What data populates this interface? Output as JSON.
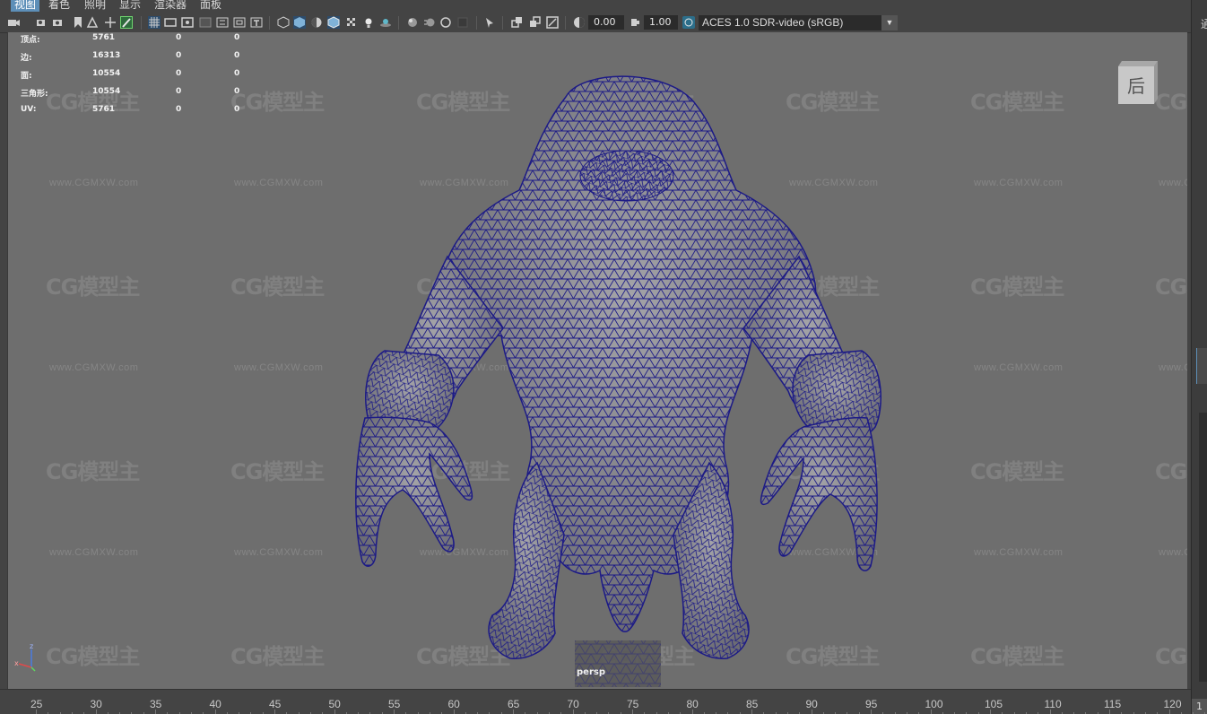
{
  "menu": {
    "items": [
      {
        "label": "视图",
        "active": true
      },
      {
        "label": "着色",
        "active": false
      },
      {
        "label": "照明",
        "active": false
      },
      {
        "label": "显示",
        "active": false
      },
      {
        "label": "渲染器",
        "active": false
      },
      {
        "label": "面板",
        "active": false
      }
    ]
  },
  "toolbar": {
    "exposure_value": "0.00",
    "gamma_value": "1.00",
    "color_space": "ACES 1.0 SDR-video (sRGB)",
    "icons": [
      "camera-select-icon",
      "camera-attributes-icon",
      "bookmark-icon",
      "image-plane-icon",
      "grease-pencil-icon",
      "grid-icon",
      "film-gate-icon",
      "resolution-gate-icon",
      "gate-mask-icon",
      "field-chart-icon",
      "safe-action-icon",
      "safe-title-icon",
      "wireframe-icon",
      "smooth-shade-icon",
      "default-material-icon",
      "wireframe-on-shaded-icon",
      "xray-icon",
      "textured-icon",
      "lights-icon",
      "shadows-icon",
      "ambient-occlusion-icon",
      "motion-blur-icon",
      "antialiasing-icon",
      "depth-of-field-icon",
      "isolate-select-icon",
      "xray-joints-icon",
      "xray-active-icon",
      "backface-icon",
      "exposure-icon",
      "gamma-icon",
      "color-management-icon"
    ]
  },
  "hud": {
    "rows": [
      {
        "label": "顶点:",
        "v1": "5761",
        "v2": "0",
        "v3": "0"
      },
      {
        "label": "边:",
        "v1": "16313",
        "v2": "0",
        "v3": "0"
      },
      {
        "label": "面:",
        "v1": "10554",
        "v2": "0",
        "v3": "0"
      },
      {
        "label": "三角形:",
        "v1": "10554",
        "v2": "0",
        "v3": "0"
      },
      {
        "label": "UV:",
        "v1": "5761",
        "v2": "0",
        "v3": "0"
      }
    ]
  },
  "viewport": {
    "camera_label": "persp",
    "viewcube_label": "后",
    "watermark_logo": "CG模型主",
    "watermark_url": "www.CGMXW.com",
    "mesh_color": "#1c1a86",
    "mesh_fill": "#8a8a8e",
    "background": "#6e6e6e"
  },
  "sidebar": {
    "top_char": "通",
    "bottom_number": "1"
  },
  "timeline": {
    "ticks": [
      "25",
      "30",
      "35",
      "40",
      "45",
      "50",
      "55",
      "60",
      "65",
      "70",
      "75",
      "80",
      "85",
      "90",
      "95",
      "100",
      "105",
      "110",
      "115",
      "120"
    ]
  }
}
